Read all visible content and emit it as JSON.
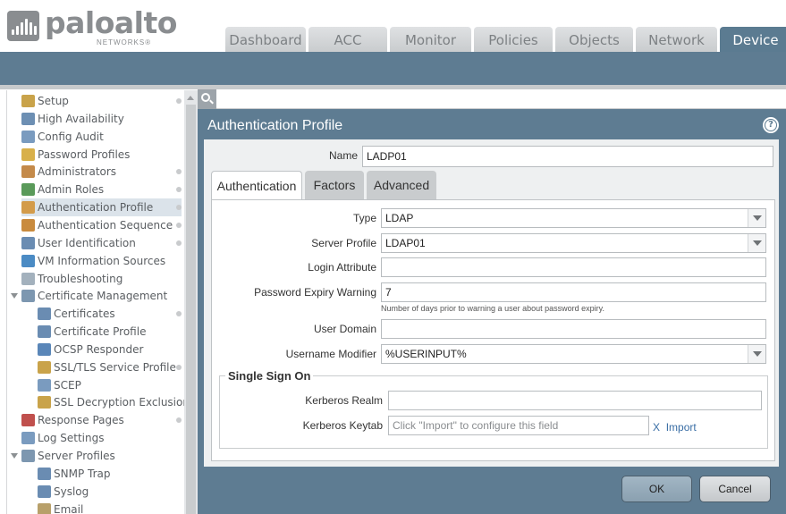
{
  "brand": {
    "name": "paloalto",
    "sub": "NETWORKS®"
  },
  "nav_tabs": [
    "Dashboard",
    "ACC",
    "Monitor",
    "Policies",
    "Objects",
    "Network",
    "Device"
  ],
  "active_tab": "Device",
  "sidebar": {
    "items": [
      {
        "label": "Setup",
        "icon": "setup-icon",
        "dot": true
      },
      {
        "label": "High Availability",
        "icon": "high-availability-icon",
        "dot": false
      },
      {
        "label": "Config Audit",
        "icon": "config-audit-icon",
        "dot": false
      },
      {
        "label": "Password Profiles",
        "icon": "password-profiles-icon",
        "dot": false
      },
      {
        "label": "Administrators",
        "icon": "administrators-icon",
        "dot": true
      },
      {
        "label": "Admin Roles",
        "icon": "admin-roles-icon",
        "dot": true
      },
      {
        "label": "Authentication Profile",
        "icon": "authentication-profile-icon",
        "dot": true
      },
      {
        "label": "Authentication Sequence",
        "icon": "authentication-sequence-icon",
        "dot": true
      },
      {
        "label": "User Identification",
        "icon": "user-identification-icon",
        "dot": true
      },
      {
        "label": "VM Information Sources",
        "icon": "vm-information-sources-icon",
        "dot": false
      },
      {
        "label": "Troubleshooting",
        "icon": "troubleshooting-icon",
        "dot": false
      },
      {
        "label": "Certificate Management",
        "icon": "certificate-management-icon",
        "dot": false
      },
      {
        "label": "Certificates",
        "icon": "certificates-icon",
        "dot": true
      },
      {
        "label": "Certificate Profile",
        "icon": "certificate-profile-icon",
        "dot": false
      },
      {
        "label": "OCSP Responder",
        "icon": "ocsp-responder-icon",
        "dot": false
      },
      {
        "label": "SSL/TLS Service Profile",
        "icon": "ssl-tls-service-profile-icon",
        "dot": true
      },
      {
        "label": "SCEP",
        "icon": "scep-icon",
        "dot": false
      },
      {
        "label": "SSL Decryption Exclusion",
        "icon": "ssl-decryption-exclusion-icon",
        "dot": false
      },
      {
        "label": "Response Pages",
        "icon": "response-pages-icon",
        "dot": true
      },
      {
        "label": "Log Settings",
        "icon": "log-settings-icon",
        "dot": false
      },
      {
        "label": "Server Profiles",
        "icon": "server-profiles-icon",
        "dot": false
      },
      {
        "label": "SNMP Trap",
        "icon": "snmp-trap-icon",
        "dot": false
      },
      {
        "label": "Syslog",
        "icon": "syslog-icon",
        "dot": false
      },
      {
        "label": "Email",
        "icon": "email-icon",
        "dot": false
      }
    ],
    "selected": "Authentication Profile"
  },
  "dialog": {
    "title": "Authentication Profile",
    "name_label": "Name",
    "name_value": "LADP01",
    "tabs": [
      "Authentication",
      "Factors",
      "Advanced"
    ],
    "active_tab": "Authentication",
    "type_label": "Type",
    "type_value": "LDAP",
    "server_profile_label": "Server Profile",
    "server_profile_value": "LDAP01",
    "login_attribute_label": "Login Attribute",
    "login_attribute_value": "",
    "password_expiry_label": "Password Expiry Warning",
    "password_expiry_value": "7",
    "password_expiry_hint": "Number of days prior to warning a user about password expiry.",
    "user_domain_label": "User Domain",
    "user_domain_value": "",
    "username_modifier_label": "Username Modifier",
    "username_modifier_value": "%USERINPUT%",
    "sso_title": "Single Sign On",
    "kerberos_realm_label": "Kerberos Realm",
    "kerberos_realm_value": "",
    "kerberos_keytab_label": "Kerberos Keytab",
    "kerberos_keytab_placeholder": "Click \"Import\" to configure this field",
    "import_prefix": "X",
    "import_label": "Import",
    "ok_label": "OK",
    "cancel_label": "Cancel"
  },
  "colors": {
    "header_blue": "#5e7c92",
    "tab_gray": "#c9ccce",
    "link_blue": "#3a6ea5"
  }
}
